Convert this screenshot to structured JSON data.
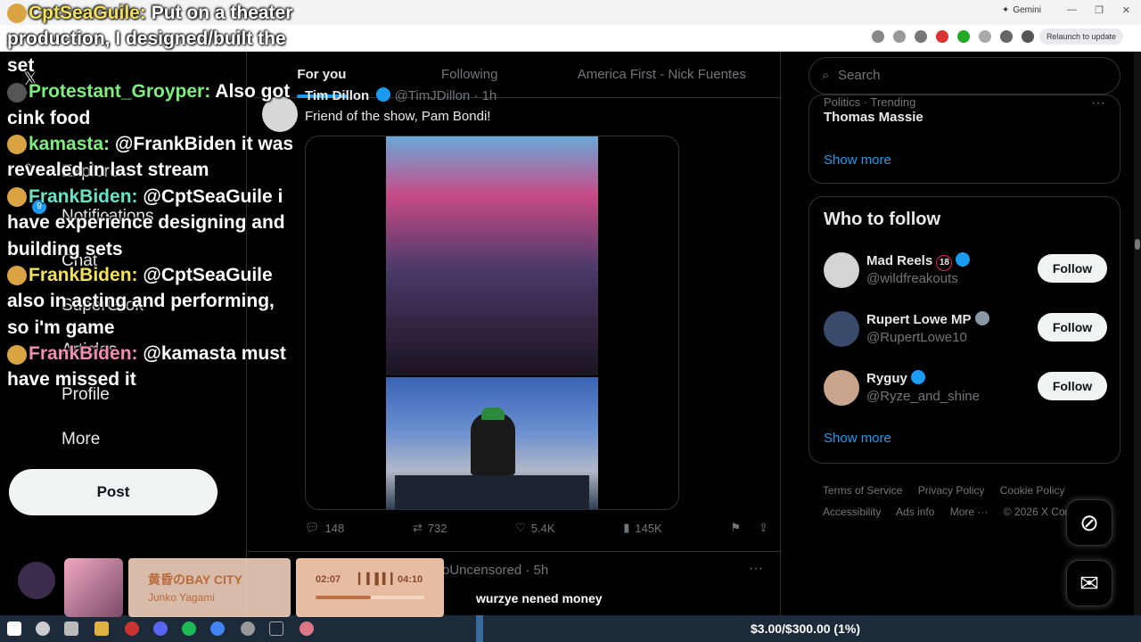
{
  "browser": {
    "gemini_label": "Gemini",
    "relaunch_label": "Relaunch to update"
  },
  "chat_overlay": [
    {
      "user": "CptSeaGuile:",
      "text": "Put on a theater production, I designed/built the set"
    },
    {
      "user": "Protestant_Groyper:",
      "text": "Also got cink food"
    },
    {
      "user": "kamasta:",
      "text": "@FrankBiden it was revealed in last stream"
    },
    {
      "user": "FrankBiden:",
      "text": "@CptSeaGuile i have experience designing and building sets"
    },
    {
      "user": "FrankBiden:",
      "text": "@CptSeaGuile also in acting and performing, so i'm game"
    },
    {
      "user": "FrankBiden:",
      "text": "@kamasta must have missed it"
    }
  ],
  "nav": {
    "items": [
      "Explore",
      "Notifications",
      "Chat",
      "SuperGrok",
      "Articles",
      "Profile",
      "More"
    ],
    "notif_count": "9",
    "post_label": "Post"
  },
  "feed": {
    "tabs": [
      "For you",
      "Following",
      "America First - Nick Fuentes"
    ],
    "tweet": {
      "author": "Tim Dillon",
      "handle": "@TimJDillon · 1h",
      "text": "Friend of the show, Pam Bondi!",
      "replies": "148",
      "reposts": "732",
      "likes": "5.4K",
      "views": "145K"
    },
    "next_tweet_handle": "oUncensored · 5h",
    "subtitle": "wurzye nened money"
  },
  "sidebar": {
    "search_placeholder": "Search",
    "trend_meta": "Politics · Trending",
    "trend_name": "Thomas Massie",
    "show_more": "Show more",
    "who_to_follow_title": "Who to follow",
    "follow_label": "Follow",
    "suggestions": [
      {
        "name": "Mad Reels",
        "badge": "18",
        "handle": "@wildfreakouts"
      },
      {
        "name": "Rupert Lowe MP",
        "handle": "@RupertLowe10"
      },
      {
        "name": "Ryguy",
        "handle": "@Ryze_and_shine"
      }
    ],
    "footer_links": [
      "Terms of Service",
      "Privacy Policy",
      "Cookie Policy",
      "Accessibility",
      "Ads info",
      "More ···",
      "© 2026 X Cor"
    ]
  },
  "music": {
    "title": "黄昏のBAY CITY",
    "artist": "Junko Yagami",
    "current_time": "02:07",
    "total_time": "04:10",
    "progress": 0.51
  },
  "taskbar": {
    "money_text": "$3.00/$300.00 (1%)"
  }
}
